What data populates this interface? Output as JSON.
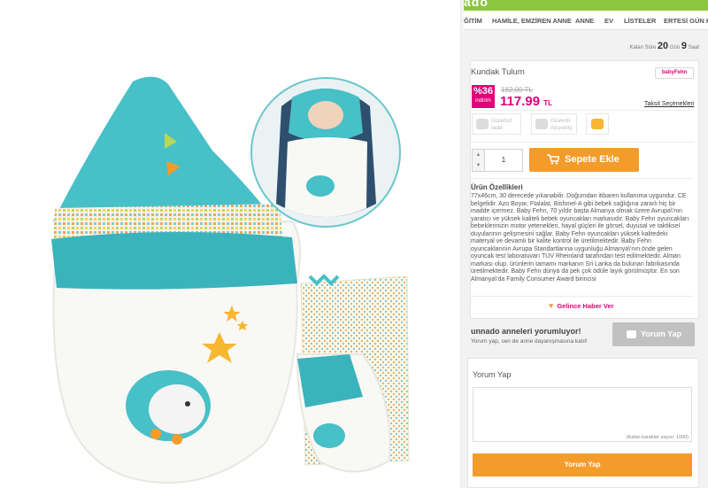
{
  "header": {
    "logo_fragment": "ado",
    "nav_items": [
      "ĞİTİM",
      "HAMİLE, EMZİREN ANNE",
      "ANNE",
      "EV",
      "LİSTELER",
      "ERTESİ GÜN KA"
    ]
  },
  "countdown": {
    "prefix": "Kalan Süre",
    "days": "20",
    "days_label": "Gün",
    "hours": "9",
    "hours_label": "Saat"
  },
  "product": {
    "title": "Kundak Tulum",
    "brand": "babyFehn",
    "discount_value": "%36",
    "discount_label": "indirim",
    "old_price": "182,00 TL",
    "new_price": "117.99",
    "currency": "TL",
    "installments_link": "Taksit Seçenekleri",
    "badges": [
      "Ücretsiz İade",
      "Güvenli Alışveriş",
      ""
    ],
    "quantity": "1",
    "add_to_cart": "Sepete Ekle"
  },
  "features": {
    "title": "Ürün Özellikleri",
    "text": "77x46cm, 30 derecede yıkanabilir. Doğumdan itibaren kullanıma uygundur. CE belgelidir. Azo Boyar, Ftalalat, Bisfonel-A gibi bebek sağlığına zararlı hiç bir madde içermez. Baby Fehn, 70 yıldır başta Almanya olmak üzere Avrupa\\'nın yaratıcı ve yüksek kaliteli bebek oyuncakları markasıdır. Baby Fehn oyuncakları bebeklerinizin motor yetenekleri, hayal güçleri ile görsel, duyusal ve taktiksel duyularının gelişmesini sağlar. Baby Fehn oyuncakları yüksek kalitedeki materyal ve devamlı bir kalite kontrol ile üretilmektedir. Baby Fehn oyuncaklarının Avrupa Standartlarına uygunluğu Almanya\\'nın önde gelen oyuncak test laboratuvarı TÜV Rheinland tarafından test edilmektedir. Alman markası olup, ürünlerin tamamı markanın Sri Lanka da bulunan fabrikasında üretilmektedir. Baby Fehn dünya da pek çok ödüle layık görülmüştür. En son Almanya\\'da Family Consumer Award birincisi"
  },
  "notify": {
    "label": "Gelince Haber Ver"
  },
  "reviews": {
    "title": "unnado anneleri yorumluyor!",
    "subtitle": "Yorum yap, sen de anne dayanışmasına katıl!",
    "button": "Yorum Yap"
  },
  "review_form": {
    "title": "Yorum Yap",
    "char_count": "(Kalan karakter sayısı: 1000)",
    "submit": "Yorum Yap"
  },
  "colors": {
    "accent_pink": "#e2007a",
    "accent_orange": "#f39c2b",
    "brand_green": "#8cc63f",
    "product_teal": "#3fbfc9"
  }
}
